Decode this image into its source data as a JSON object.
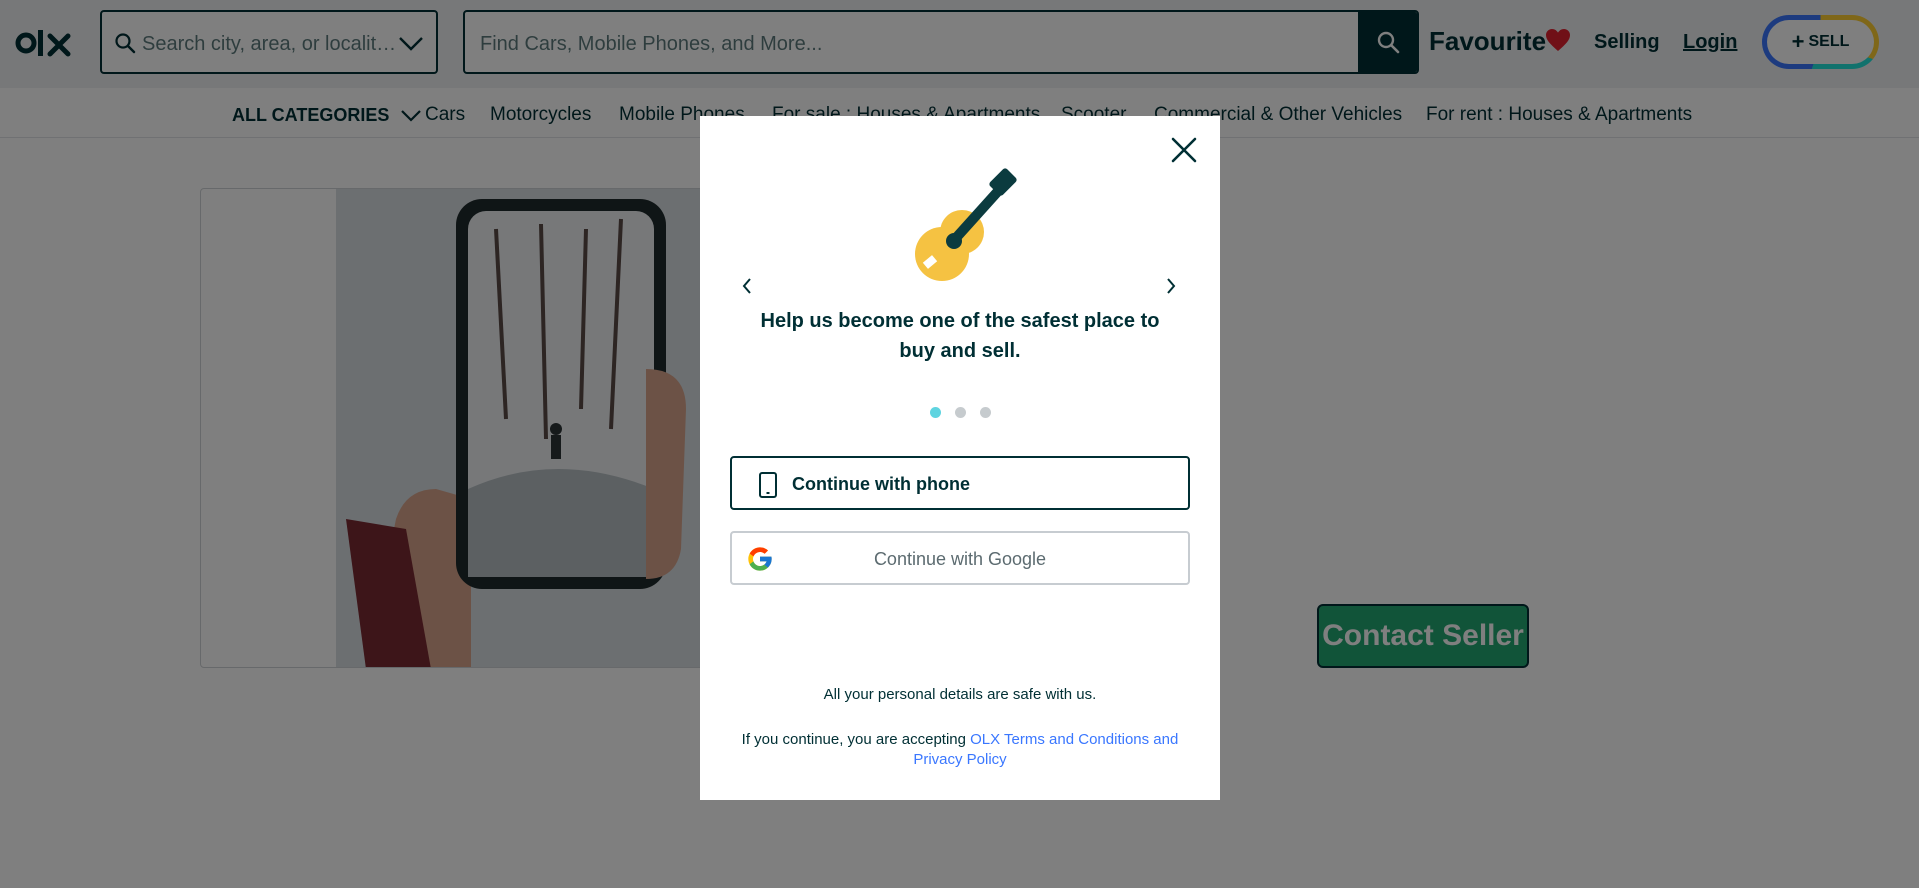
{
  "header": {
    "logo_text": "olx",
    "location_placeholder": "Search city, area, or locality...",
    "search_placeholder": "Find Cars, Mobile Phones, and More...",
    "favourite_label": "Favourite",
    "selling_label": "Selling",
    "login_label": "Login",
    "sell_label": "SELL",
    "sell_plus": "+"
  },
  "categories": {
    "all_label": "ALL CATEGORIES",
    "items": [
      "Cars",
      "Motorcycles",
      "Mobile Phones",
      "For sale : Houses & Apartments",
      "Scooter",
      "Commercial & Other Vehicles",
      "For rent : Houses & Apartments"
    ]
  },
  "listing": {
    "contact_label": "Contact Seller"
  },
  "modal": {
    "headline": "Help us become one of the safest place to buy and sell.",
    "slides_total": 3,
    "active_slide": 1,
    "phone_button": "Continue with phone",
    "google_button": "Continue with Google",
    "safe_text": "All your personal details are safe with us.",
    "terms_prefix": "If you continue, you are accepting",
    "terms_link": "OLX Terms and Conditions and Privacy Policy"
  },
  "colors": {
    "brand": "#002f34",
    "contact_green": "#23a873",
    "link_blue": "#3a77ff",
    "active_dot": "#5fd4e0",
    "heart_red": "#e0202f"
  }
}
